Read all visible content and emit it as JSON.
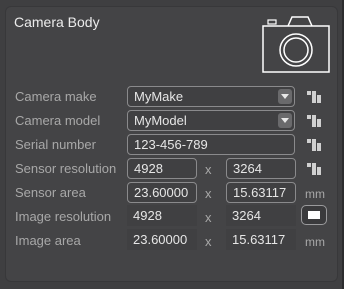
{
  "panel": {
    "title": "Camera Body"
  },
  "rows": {
    "make": {
      "label": "Camera make",
      "value": "MyMake"
    },
    "model": {
      "label": "Camera model",
      "value": "MyModel"
    },
    "serial": {
      "label": "Serial number",
      "value": "123-456-789"
    },
    "sensor_resolution": {
      "label": "Sensor resolution",
      "width": "4928",
      "height": "3264"
    },
    "sensor_area": {
      "label": "Sensor area",
      "width": "23.60000",
      "height": "15.63117",
      "unit": "mm"
    },
    "image_resolution": {
      "label": "Image resolution",
      "width": "4928",
      "height": "3264"
    },
    "image_area": {
      "label": "Image area",
      "width": "23.60000",
      "height": "15.63117",
      "unit": "mm"
    }
  },
  "separator": "x",
  "icons": {
    "camera": "camera-outline-icon",
    "presets": "preset-grid-icon",
    "aspect": "aspect-ratio-icon"
  }
}
